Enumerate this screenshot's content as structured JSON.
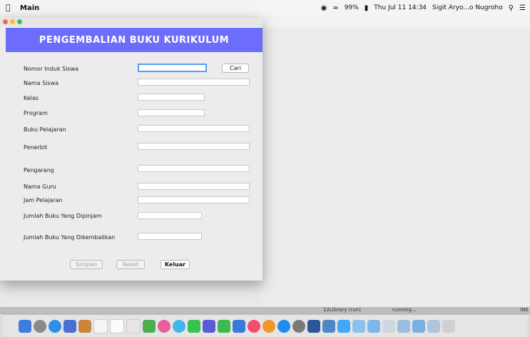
{
  "menubar": {
    "app_name": "Main",
    "battery": "99%",
    "datetime": "Thu Jul 11  14:34",
    "user": "Sigit Aryo...o Nugroho",
    "icons": [
      "apple-icon",
      "wifi-icon",
      "battery-icon",
      "search-icon",
      "list-icon"
    ]
  },
  "window": {
    "banner_title": "PENGEMBALIAN BUKU KURIKULUM",
    "fields": [
      {
        "label": "Nomor Induk Siswa",
        "value": ""
      },
      {
        "label": "Nama Siswa",
        "value": ""
      },
      {
        "label": "Kelas",
        "value": ""
      },
      {
        "label": "Program",
        "value": ""
      },
      {
        "label": "Buku Pelajaran",
        "value": ""
      },
      {
        "label": "Penerbit",
        "value": ""
      },
      {
        "label": "Pengarang",
        "value": ""
      },
      {
        "label": "Nama Guru",
        "value": ""
      },
      {
        "label": "Jam Pelajaran",
        "value": ""
      },
      {
        "label": "Jumlah Buku Yang Dipinjam",
        "value": ""
      },
      {
        "label": "Jumlah Buku Yang Dikembalikan",
        "value": ""
      }
    ],
    "search_button": "Cari",
    "buttons": {
      "save": "Simpan",
      "reset": "Reset",
      "exit": "Keluar"
    }
  },
  "statusbar": {
    "project": "12Library (run)",
    "state": "running...",
    "indicator": "INS"
  },
  "colors": {
    "banner": "#6d6dfc",
    "focus": "#5b9bf0"
  }
}
